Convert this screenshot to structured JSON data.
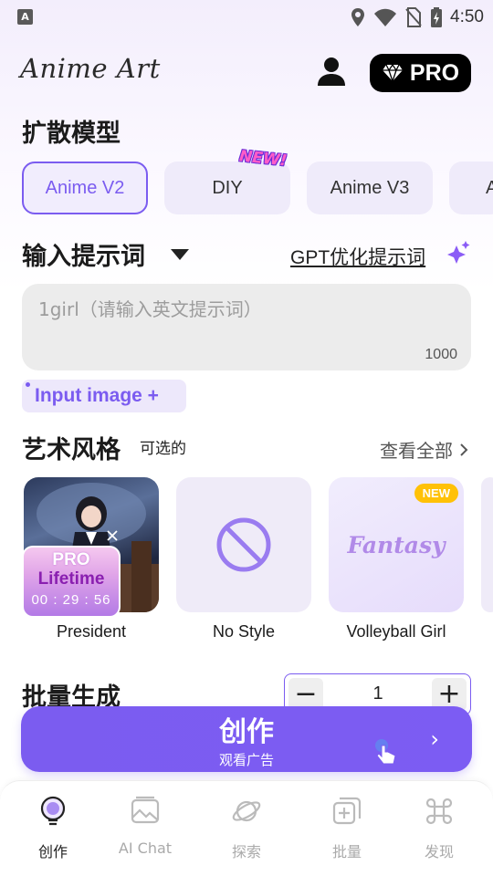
{
  "status_bar": {
    "time": "4:50"
  },
  "header": {
    "logo": "Anime Art",
    "pro_label": "PRO"
  },
  "diffusion": {
    "title": "扩散模型",
    "models": [
      {
        "label": "Anime V2",
        "active": true
      },
      {
        "label": "DIY",
        "badge": "NEW!"
      },
      {
        "label": "Anime V3"
      },
      {
        "label": "A"
      }
    ]
  },
  "prompt": {
    "title": "输入提示词",
    "gpt_link": "GPT优化提示词",
    "placeholder": "1girl（请输入英文提示词）",
    "max_chars": "1000",
    "input_image": "Input image +"
  },
  "art_style": {
    "title": "艺术风格",
    "optional": "可选的",
    "view_all": "查看全部",
    "styles": [
      {
        "label": "President"
      },
      {
        "label": "No Style"
      },
      {
        "label": "Volleyball Girl",
        "card_text": "Fantasy",
        "badge": "NEW"
      }
    ],
    "promo": {
      "pro": "PRO",
      "lifetime": "Lifetime",
      "timer": "00 : 29 : 56"
    }
  },
  "batch": {
    "title": "批量生成",
    "value": "1",
    "minus": "−",
    "plus": "+"
  },
  "create": {
    "main": "创作",
    "sub": "观看广告"
  },
  "nav": [
    {
      "label": "创作",
      "icon": "bulb-icon",
      "active": true
    },
    {
      "label": "AI Chat",
      "icon": "image-icon"
    },
    {
      "label": "探索",
      "icon": "planet-icon"
    },
    {
      "label": "批量",
      "icon": "batch-add-icon"
    },
    {
      "label": "发现",
      "icon": "command-icon"
    }
  ],
  "colors": {
    "accent": "#7b5cf0",
    "pro_bg": "#000000",
    "new_badge": "#ffc107"
  }
}
